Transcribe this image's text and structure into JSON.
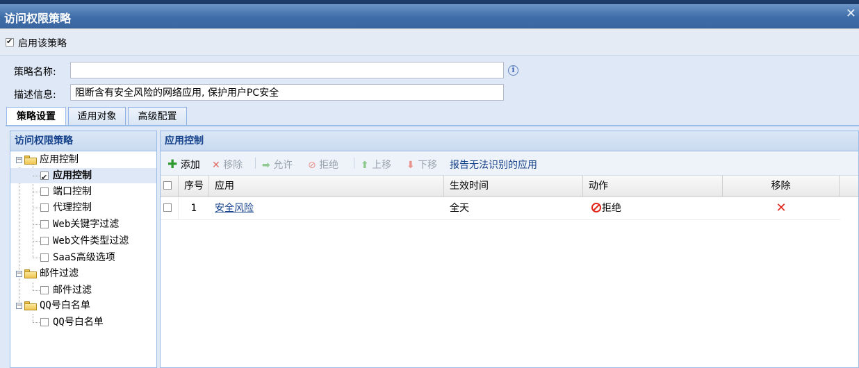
{
  "window": {
    "title": "访问权限策略",
    "close_glyph": "✕"
  },
  "enable": {
    "label": "启用该策略",
    "checked": true
  },
  "form": {
    "name_label": "策略名称:",
    "name_value": "",
    "desc_label": "描述信息:",
    "desc_value": "阻断含有安全风险的网络应用, 保护用户PC安全"
  },
  "tabs": [
    {
      "label": "策略设置",
      "active": true
    },
    {
      "label": "适用对象",
      "active": false
    },
    {
      "label": "高级配置",
      "active": false
    }
  ],
  "tree": {
    "header": "访问权限策略",
    "groups": [
      {
        "label": "应用控制",
        "items": [
          "应用控制",
          "端口控制",
          "代理控制",
          "Web关键字过滤",
          "Web文件类型过滤",
          "SaaS高级选项"
        ]
      },
      {
        "label": "邮件过滤",
        "items": [
          "邮件过滤"
        ]
      },
      {
        "label": "QQ号白名单",
        "items": [
          "QQ号白名单"
        ]
      }
    ],
    "selected": "应用控制"
  },
  "main": {
    "header": "应用控制",
    "toolbar": {
      "add": "添加",
      "remove": "移除",
      "allow": "允许",
      "deny": "拒绝",
      "move_up": "上移",
      "move_down": "下移",
      "report": "报告无法识别的应用"
    },
    "columns": {
      "seq": "序号",
      "app": "应用",
      "time": "生效时间",
      "action": "动作",
      "remove": "移除"
    },
    "rows": [
      {
        "seq": "1",
        "app": "安全风险",
        "time": "全天",
        "action": "拒绝"
      }
    ]
  },
  "colors": {
    "title_bar": "#3f6da8",
    "deny": "#e0261b",
    "add": "#2f9a2f",
    "link": "#15428b"
  }
}
